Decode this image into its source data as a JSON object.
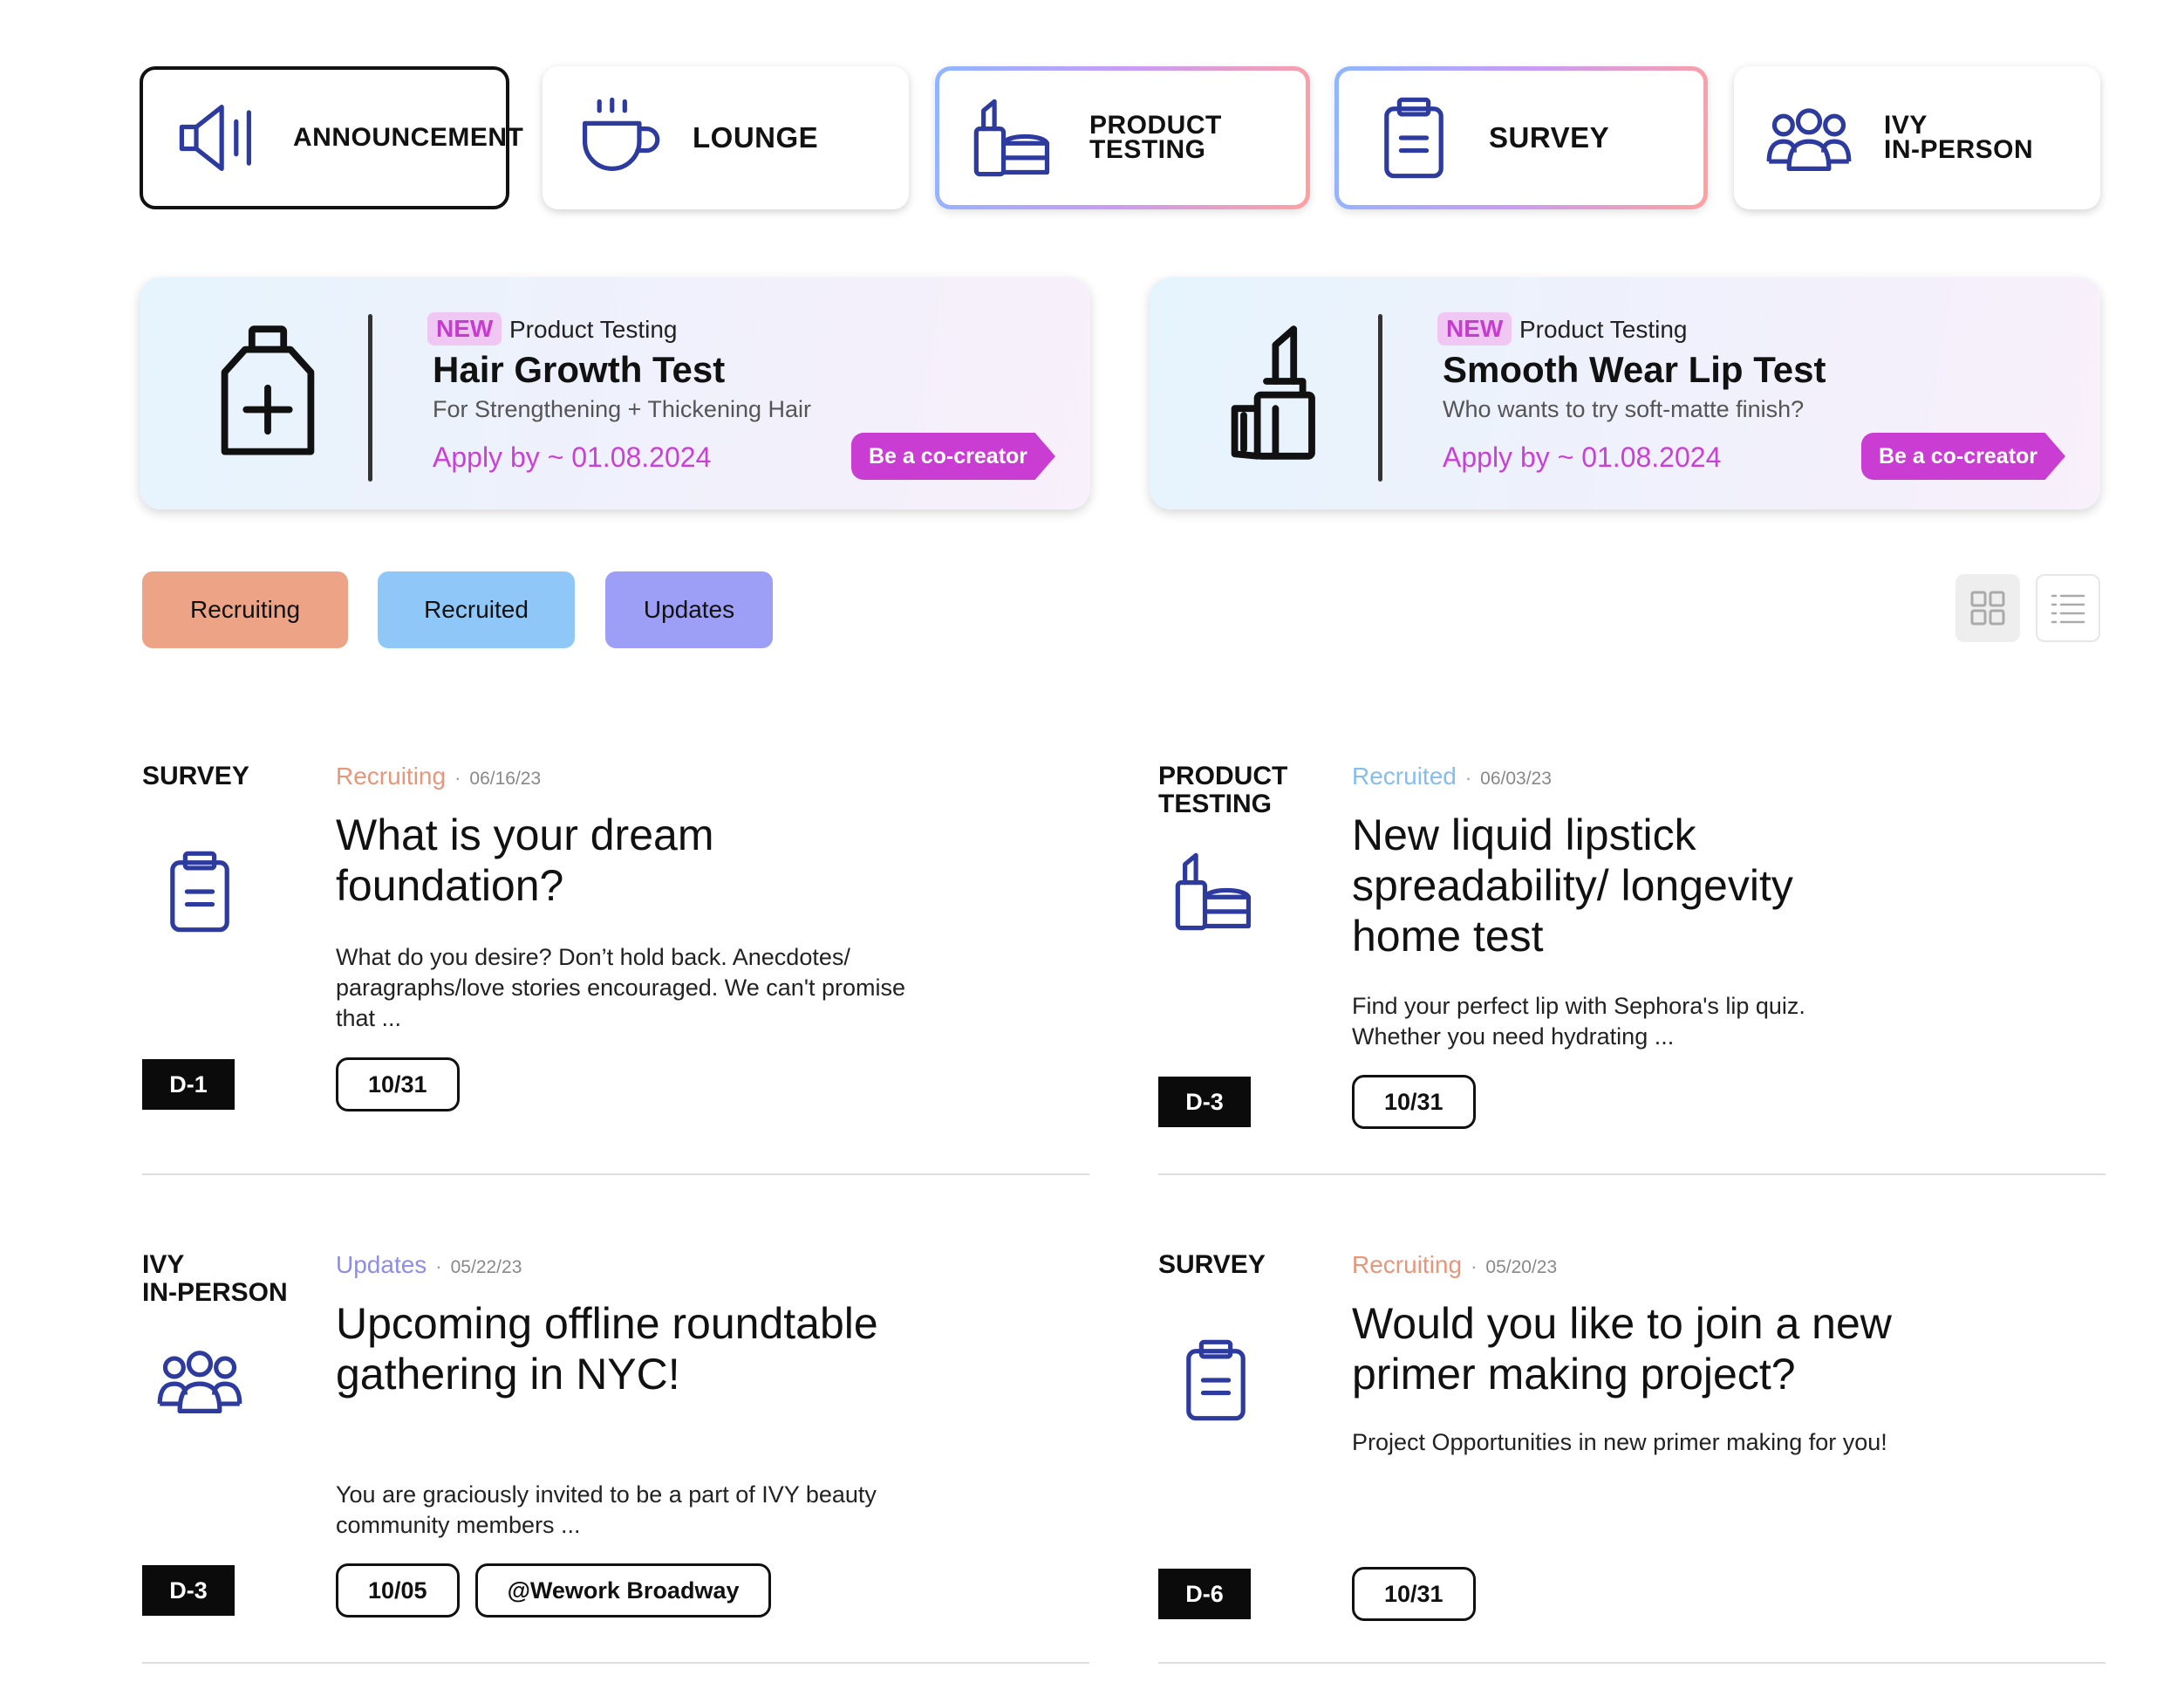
{
  "categories": [
    {
      "label": "ANNOUNCEMENT",
      "icon": "megaphone-icon"
    },
    {
      "label": "LOUNGE",
      "icon": "coffee-cup-icon"
    },
    {
      "label": "PRODUCT\nTESTING",
      "icon": "cosmetics-icon"
    },
    {
      "label": "SURVEY",
      "icon": "clipboard-icon"
    },
    {
      "label": "IVY\nIN-PERSON",
      "icon": "group-icon"
    }
  ],
  "banners": [
    {
      "new": "NEW",
      "category": "Product Testing",
      "title": "Hair Growth Test",
      "subtitle": "For Strengthening + Thickening Hair",
      "apply": "Apply by ~ 01.08.2024",
      "cta": "Be a co-creator",
      "icon": "bottle-plus-icon"
    },
    {
      "new": "NEW",
      "category": "Product Testing",
      "title": "Smooth Wear Lip Test",
      "subtitle": "Who wants to try soft-matte finish?",
      "apply": "Apply by ~ 01.08.2024",
      "cta": "Be a co-creator",
      "icon": "lipstick-icon"
    }
  ],
  "filters": [
    "Recruiting",
    "Recruited",
    "Updates"
  ],
  "colors": {
    "recruiting": "#eda386",
    "recruited": "#8fc8f8",
    "updates": "#9d9ef5",
    "recruiting_text": "#e8957a",
    "recruited_text": "#86bdf0",
    "updates_text": "#8d8de8",
    "icon_blue": "#2d3a9e",
    "accent_pink": "#c93dd2"
  },
  "posts": [
    {
      "type": "SURVEY",
      "status": "Recruiting",
      "date": "06/16/23",
      "title": "What is your dream foundation?",
      "desc": "What do you desire? Don’t hold back. Anecdotes/ paragraphs/love stories encouraged. We can't promise that ...",
      "dday": "D-1",
      "chips": [
        "10/31"
      ],
      "icon": "clipboard-icon"
    },
    {
      "type": "PRODUCT\nTESTING",
      "status": "Recruited",
      "date": "06/03/23",
      "title": "New liquid lipstick spreadability/ longevity home test",
      "desc": "Find your perfect lip with Sephora's lip quiz. Whether you need hydrating ...",
      "dday": "D-3",
      "chips": [
        "10/31"
      ],
      "icon": "cosmetics-icon"
    },
    {
      "type": "IVY\nIN-PERSON",
      "status": "Updates",
      "date": "05/22/23",
      "title": "Upcoming offline roundtable gathering in NYC!",
      "desc": "You are graciously invited to be a part of IVY beauty community members ...",
      "dday": "D-3",
      "chips": [
        "10/05",
        "@Wework Broadway"
      ],
      "icon": "group-icon"
    },
    {
      "type": "SURVEY",
      "status": "Recruiting",
      "date": "05/20/23",
      "title": "Would you like to join a new primer making project?",
      "desc": "Project Opportunities in new primer making for you!",
      "dday": "D-6",
      "chips": [
        "10/31"
      ],
      "icon": "clipboard-icon"
    }
  ]
}
